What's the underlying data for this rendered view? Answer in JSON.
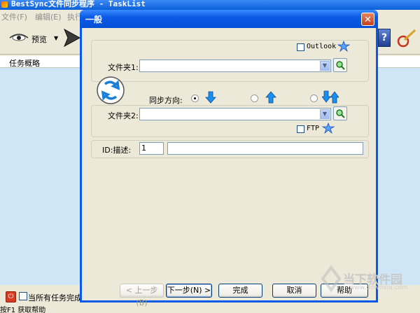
{
  "main_window": {
    "title": "BestSync文件同步程序 - TaskList",
    "menu": [
      {
        "label": "文件(F)"
      },
      {
        "label": "编辑(E)"
      },
      {
        "label": "执行"
      }
    ],
    "toolbar": {
      "preview_label": "预览",
      "preview_dropdown": "▼"
    },
    "help_icon_glyph": "?",
    "task_list_header": "任务概略",
    "bottom": {
      "power_glyph": "⏻",
      "auto_close_label": "当所有任务完成"
    },
    "status_text": "按F1 获取帮助"
  },
  "dialog": {
    "title": "一般",
    "close_glyph": "✕",
    "outlook_label": "Outlook",
    "ftp_label": "FTP",
    "folder1_label": "文件夹1:",
    "folder1_value": "",
    "folder2_label": "文件夹2:",
    "folder2_value": "",
    "sync_direction_label": "同步方向:",
    "direction_options": [
      {
        "icon": "arrow-down-icon",
        "selected": true
      },
      {
        "icon": "arrow-up-icon",
        "selected": false
      },
      {
        "icon": "arrow-bidirectional-icon",
        "selected": false
      }
    ],
    "id_desc_label": "ID:描述:",
    "id_value": "1",
    "description_value": "",
    "buttons": {
      "back": "< 上一步(B)",
      "next": "下一步(N) >",
      "finish": "完成",
      "cancel": "取消",
      "help": "帮助"
    }
  },
  "watermark": {
    "text": "当下软件园",
    "url": "www.downxia.com"
  },
  "colors": {
    "titlebar": "#0a5ae8",
    "close": "#d55a33",
    "task_list_bg": "#cfe6f7",
    "arrow": "#1a7fd9"
  }
}
